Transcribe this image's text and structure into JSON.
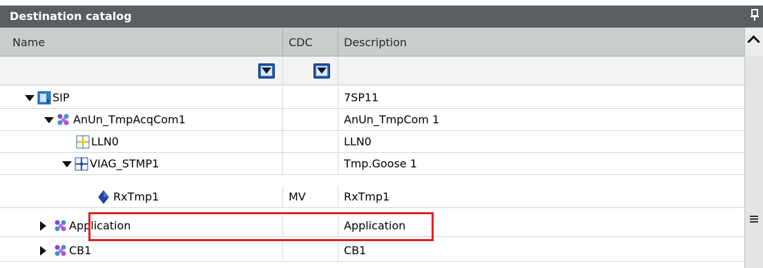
{
  "panel": {
    "title": "Destination catalog"
  },
  "columns": {
    "name": "Name",
    "cdc": "CDC",
    "description": "Description"
  },
  "rows": [
    {
      "name": "SIP",
      "cdc": "",
      "description": "7SP11",
      "icon": "device-icon",
      "expander": "expanded"
    },
    {
      "name": "AnUn_TmpAcqCom1",
      "cdc": "",
      "description": "AnUn_TmpCom 1",
      "icon": "logical-device-icon",
      "expander": "expanded"
    },
    {
      "name": "LLN0",
      "cdc": "",
      "description": "LLN0",
      "icon": "logical-node-icon",
      "expander": "none"
    },
    {
      "name": "VIAG_STMP1",
      "cdc": "",
      "description": "Tmp.Goose 1",
      "icon": "logical-node-icon",
      "expander": "expanded"
    },
    {
      "name": "RxTmp1",
      "cdc": "MV",
      "description": "RxTmp1",
      "icon": "data-object-icon",
      "expander": "none"
    },
    {
      "name": "Application",
      "cdc": "",
      "description": "Application",
      "icon": "logical-device-icon",
      "expander": "collapsed"
    },
    {
      "name": "CB1",
      "cdc": "",
      "description": "CB1",
      "icon": "logical-device-icon",
      "expander": "collapsed"
    }
  ],
  "colors": {
    "highlight": "#e02020",
    "titlebar": "#5a5d61",
    "filter_button": "#2d6ad0"
  }
}
